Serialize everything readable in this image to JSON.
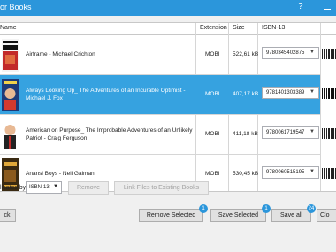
{
  "window": {
    "title": "or Books",
    "help": "?"
  },
  "columns": {
    "name": "Name",
    "extension": "Extension",
    "size": "Size",
    "isbn": "ISBN-13"
  },
  "rows": [
    {
      "cover_text": "MICHAEL CRICHTON AIRFRAME",
      "name_line1": "Airframe - Michael Crichton",
      "name_line2": "",
      "extension": "MOBI",
      "size": "522,61 kB",
      "isbn": "9780345402875",
      "selected": false
    },
    {
      "cover_text": "MICHAEL J. FOX ALWAYS LOOKING UP",
      "name_line1": "Always Looking Up_ The Adventures of an Incurable Optimist -",
      "name_line2": "Michael J. Fox",
      "extension": "MOBI",
      "size": "407,17 kB",
      "isbn": "9781401303389",
      "selected": true
    },
    {
      "cover_text": "CRAIG FERGUSON",
      "name_line1": "American on Purpose_ The Improbable Adventures of an Unlikely",
      "name_line2": "Patriot - Craig Ferguson",
      "extension": "MOBI",
      "size": "411,18 kB",
      "isbn": "9780061719547",
      "selected": false
    },
    {
      "cover_text": "ANANSI BOYS",
      "name_line1": "Anansi Boys - Neil Gaiman",
      "name_line2": "",
      "extension": "MOBI",
      "size": "530,45 kB",
      "isbn": "9780060515195",
      "selected": false
    }
  ],
  "duplicates": {
    "label": "licates by:",
    "selected": "ISBN-13"
  },
  "buttons": {
    "remove": "Remove",
    "link_files": "Link Files to Existing Books",
    "back": "ck",
    "remove_selected": "Remove Selected",
    "remove_selected_count": "1",
    "save_selected": "Save Selected",
    "save_selected_count": "1",
    "save_all": "Save all",
    "save_all_count": "24",
    "close": "Clo"
  }
}
